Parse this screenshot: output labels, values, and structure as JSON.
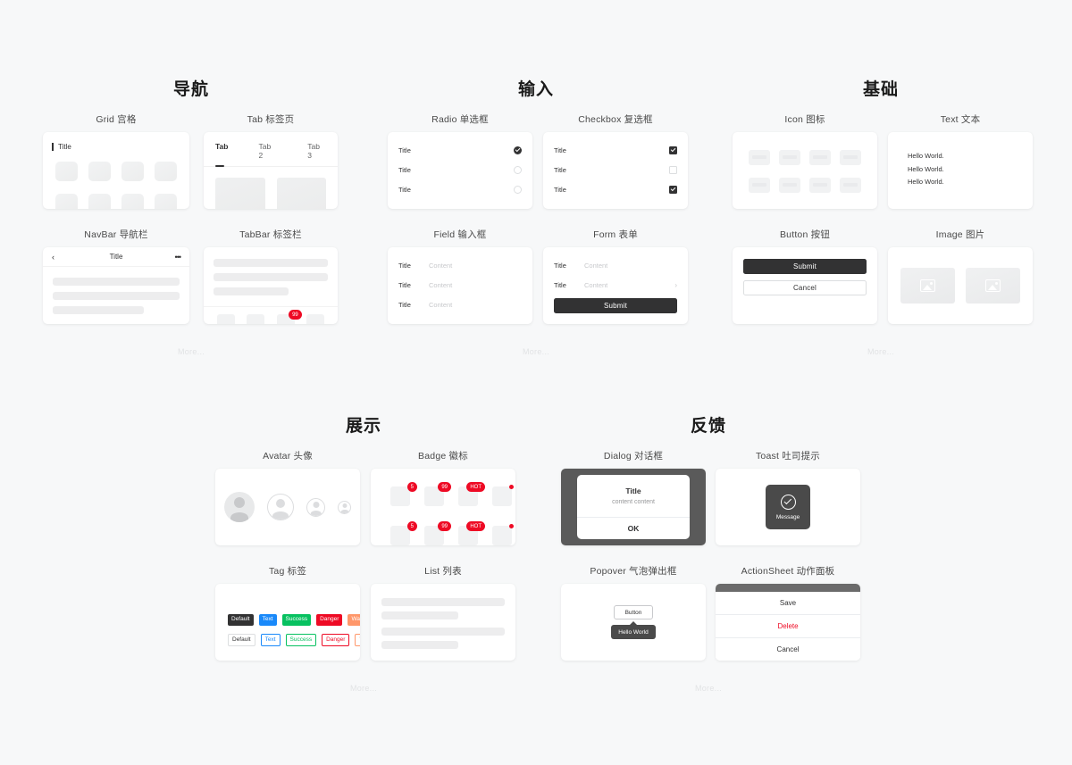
{
  "groups": {
    "nav": "导航",
    "input": "输入",
    "basic": "基础",
    "display": "展示",
    "feedback": "反馈"
  },
  "more_label": "More...",
  "components": {
    "grid": {
      "label": "Grid 宫格",
      "title": "Title",
      "cells": 8
    },
    "tab": {
      "label": "Tab 标签页",
      "tabs": [
        "Tab",
        "Tab 2",
        "Tab 3"
      ],
      "active": 0
    },
    "navbar": {
      "label": "NavBar 导航栏",
      "title": "Title",
      "back_icon": "chevron-left-icon",
      "more_icon": "ellipsis-icon"
    },
    "tabbar": {
      "label": "TabBar 标签栏",
      "items": 4,
      "badge": {
        "index": 2,
        "text": "99"
      }
    },
    "radio": {
      "label": "Radio 单选框",
      "rows": [
        {
          "title": "Title",
          "checked": true
        },
        {
          "title": "Title",
          "checked": false
        },
        {
          "title": "Title",
          "checked": false
        }
      ]
    },
    "checkbox": {
      "label": "Checkbox 复选框",
      "rows": [
        {
          "title": "Title",
          "checked": true
        },
        {
          "title": "Title",
          "checked": false
        },
        {
          "title": "Title",
          "checked": true
        }
      ]
    },
    "field": {
      "label": "Field 输入框",
      "rows": [
        {
          "title": "Title",
          "placeholder": "Content"
        },
        {
          "title": "Title",
          "placeholder": "Content"
        },
        {
          "title": "Title",
          "placeholder": "Content"
        }
      ]
    },
    "form": {
      "label": "Form 表单",
      "rows": [
        {
          "title": "Title",
          "placeholder": "Content",
          "arrow": false
        },
        {
          "title": "Title",
          "placeholder": "Content",
          "arrow": true
        }
      ],
      "submit": "Submit"
    },
    "icon": {
      "label": "Icon 图标",
      "count": 8
    },
    "text": {
      "label": "Text 文本",
      "lines": [
        "Hello World.",
        "Hello World.",
        "Hello World."
      ]
    },
    "button": {
      "label": "Button 按钮",
      "primary": "Submit",
      "default": "Cancel"
    },
    "image": {
      "label": "Image 图片",
      "count": 2
    },
    "avatar": {
      "label": "Avatar 头像",
      "sizes": [
        34,
        30,
        21,
        15
      ]
    },
    "badge": {
      "label": "Badge 徽标",
      "values": [
        "5",
        "99",
        "HOT",
        ""
      ]
    },
    "tag": {
      "label": "Tag 标签",
      "items": [
        {
          "text": "Default",
          "color": "#323233"
        },
        {
          "text": "Text",
          "color": "#1989fa"
        },
        {
          "text": "Success",
          "color": "#07c160"
        },
        {
          "text": "Danger",
          "color": "#ee0a24"
        },
        {
          "text": "Warning",
          "color": "#ff976a"
        }
      ]
    },
    "list": {
      "label": "List 列表"
    },
    "dialog": {
      "label": "Dialog 对话框",
      "title": "Title",
      "content": "content content",
      "ok": "OK"
    },
    "toast": {
      "label": "Toast 吐司提示",
      "message": "Message",
      "icon": "success-check-icon"
    },
    "popover": {
      "label": "Popover 气泡弹出框",
      "button": "Button",
      "bubble": "Hello World"
    },
    "actionsheet": {
      "label": "ActionSheet 动作面板",
      "items": [
        {
          "text": "Save",
          "danger": false
        },
        {
          "text": "Delete",
          "danger": true
        },
        {
          "text": "Cancel",
          "danger": false
        }
      ]
    }
  }
}
